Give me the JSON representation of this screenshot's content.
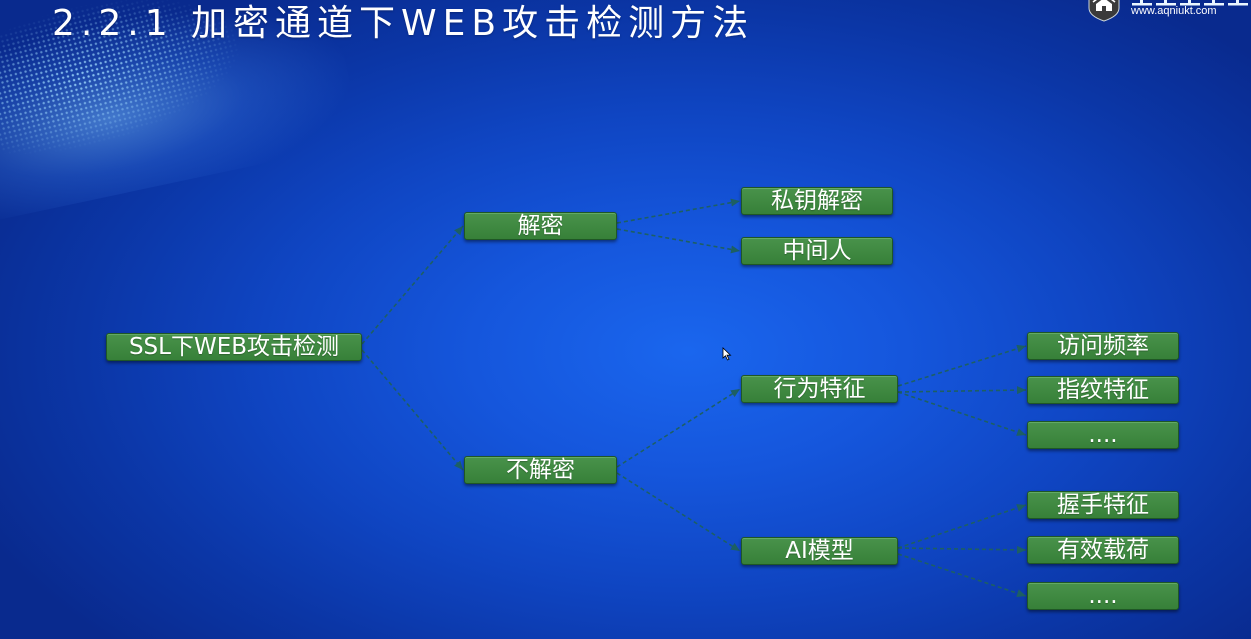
{
  "slide": {
    "title": "2.2.1 加密通道下WEB攻击检测方法",
    "logo": {
      "icon": "shield-logo-icon",
      "url": "www.aqniukt.com"
    }
  },
  "tree": {
    "label": "SSL下WEB攻击检测",
    "children": [
      {
        "label": "解密",
        "children": [
          {
            "label": "私钥解密"
          },
          {
            "label": "中间人"
          }
        ]
      },
      {
        "label": "不解密",
        "children": [
          {
            "label": "行为特征",
            "children": [
              {
                "label": "访问频率"
              },
              {
                "label": "指纹特征"
              },
              {
                "label": "...."
              }
            ]
          },
          {
            "label": "AI模型",
            "children": [
              {
                "label": "握手特征"
              },
              {
                "label": "有效载荷"
              },
              {
                "label": "...."
              }
            ]
          }
        ]
      }
    ]
  },
  "icons": {
    "cursor": "mouse-pointer-icon"
  },
  "colors": {
    "node_fill": "#3b8a3d",
    "node_border": "#1f5726",
    "node_text": "#ffffff",
    "connector": "#1d5f63",
    "title_text": "#ffffff"
  }
}
